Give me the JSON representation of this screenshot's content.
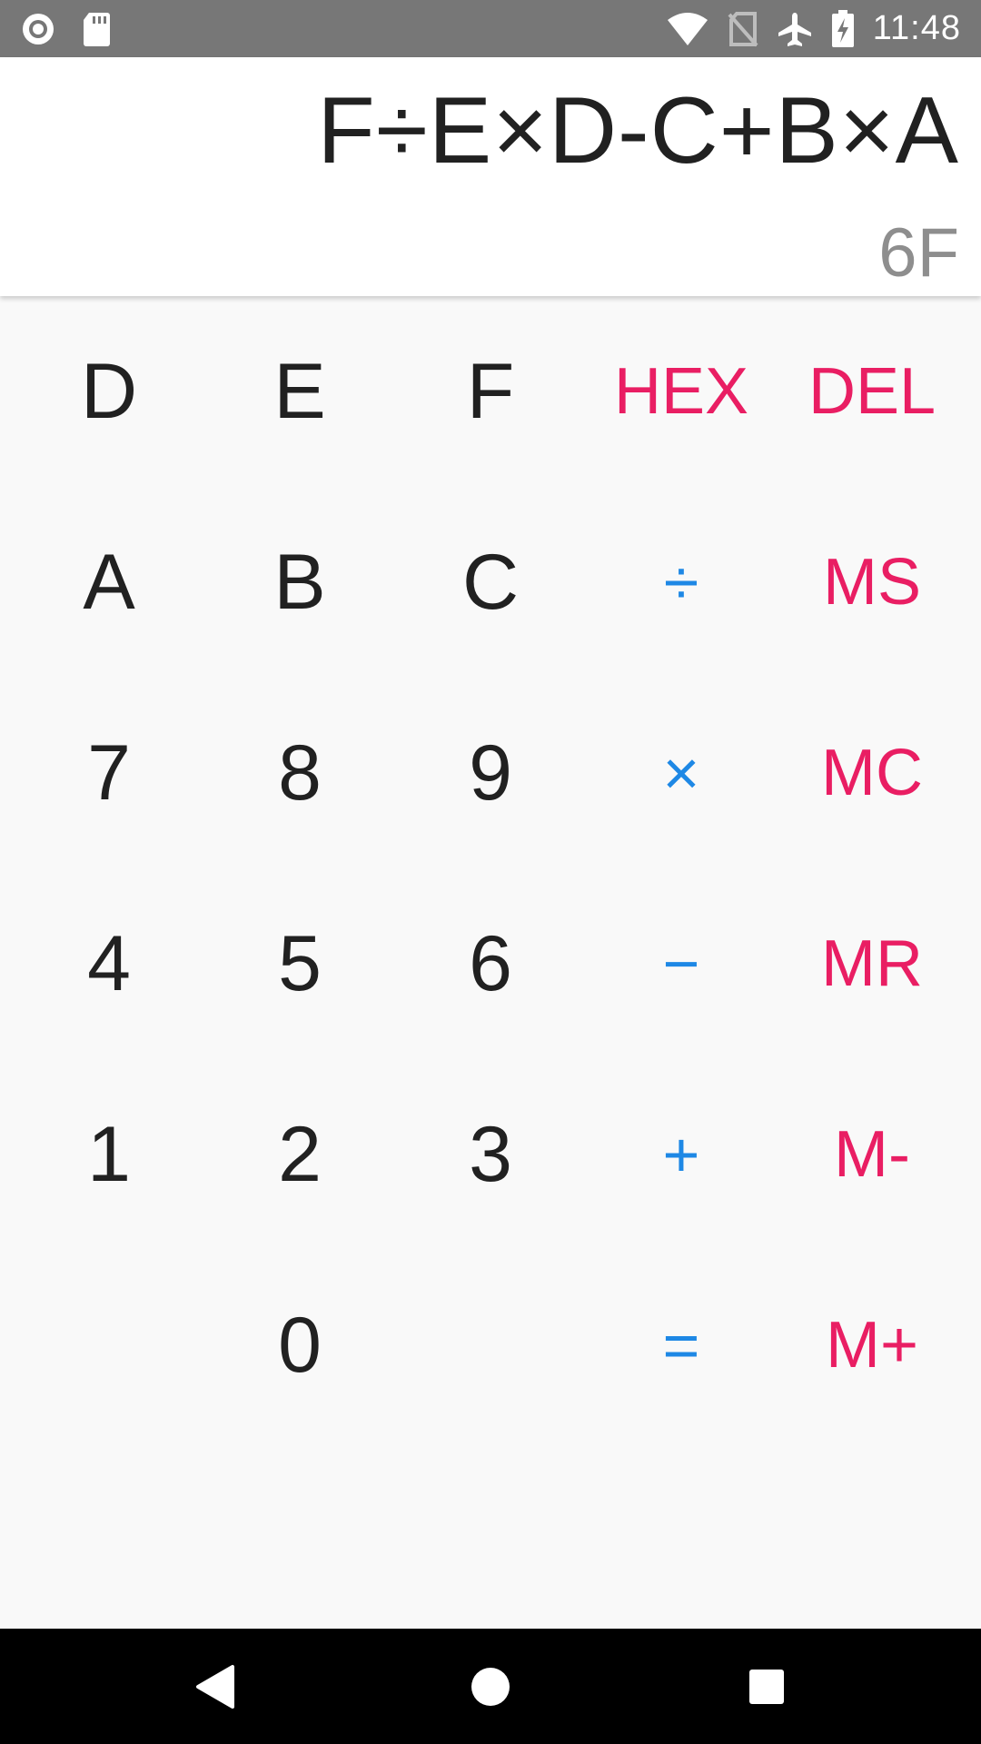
{
  "status_bar": {
    "time": "11:48",
    "icons": [
      "record-icon",
      "sd-card-icon",
      "wifi-icon",
      "no-sim-icon",
      "airplane-icon",
      "battery-charging-icon"
    ]
  },
  "display": {
    "expression": "F÷E×D-C+B×A",
    "result": "6F"
  },
  "keypad": {
    "rows": [
      [
        "D",
        "E",
        "F",
        "HEX",
        "DEL"
      ],
      [
        "A",
        "B",
        "C",
        "÷",
        "MS"
      ],
      [
        "7",
        "8",
        "9",
        "×",
        "MC"
      ],
      [
        "4",
        "5",
        "6",
        "−",
        "MR"
      ],
      [
        "1",
        "2",
        "3",
        "+",
        "M-"
      ],
      [
        "",
        "0",
        "",
        "=",
        "M+"
      ]
    ]
  },
  "colors": {
    "digit": "#212121",
    "operator": "#1e88e5",
    "function": "#e91e63",
    "status_bar": "#777777",
    "nav_bar": "#000000"
  },
  "nav_bar": {
    "icons": [
      "back-icon",
      "home-icon",
      "recents-icon"
    ]
  }
}
